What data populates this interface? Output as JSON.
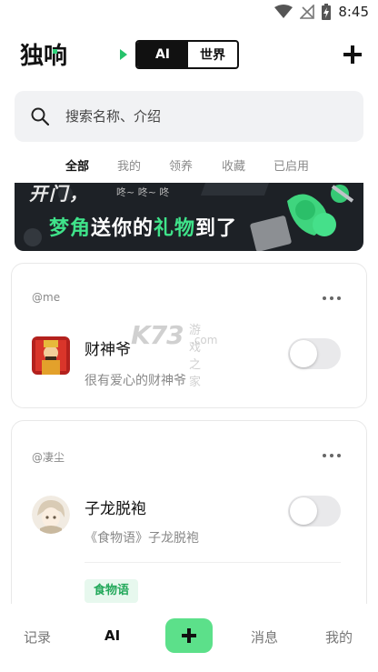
{
  "status_bar": {
    "time": "8:45"
  },
  "header": {
    "logo_text": "独响",
    "mode_ai": "AI",
    "mode_world": "世界"
  },
  "search": {
    "placeholder": "搜索名称、介绍"
  },
  "tabs": [
    "全部",
    "我的",
    "领养",
    "收藏",
    "已启用"
  ],
  "banner": {
    "top_text": "开门，",
    "top_small": "咚~ 咚~ 咚",
    "line_part1": "梦角",
    "line_part2": "送你的",
    "line_part3": "礼物",
    "line_part4": "到了"
  },
  "cards": [
    {
      "author": "@me",
      "name": "财神爷",
      "description": "很有爱心的财神爷",
      "enabled": false
    },
    {
      "author": "@凄尘",
      "name": "子龙脱袍",
      "description": "《食物语》子龙脱袍",
      "tag": "食物语",
      "enabled": false
    }
  ],
  "watermark": {
    "big": "K73",
    "small": "游戏之家",
    "com": ".com"
  },
  "bottom_nav": {
    "records": "记录",
    "ai": "AI",
    "messages": "消息",
    "mine": "我的"
  },
  "colors": {
    "accent": "#5ce08a",
    "tag_bg": "#e7f8ee",
    "tag_text": "#22a85a"
  }
}
